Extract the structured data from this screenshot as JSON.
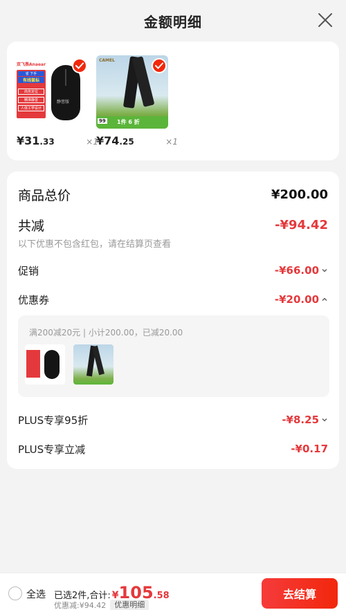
{
  "header": {
    "title": "金额明细"
  },
  "products": [
    {
      "price_int": "¥31",
      "price_dec": ".33",
      "qty": "×1"
    },
    {
      "price_int": "¥74",
      "price_dec": ".25",
      "qty": "×1"
    }
  ],
  "product_image_text": {
    "mouse_brand": "双飞燕Anaear",
    "mouse_tag1": "省 下手",
    "mouse_tag2": "有线鼠标",
    "mouse_tag3": "商务定位",
    "mouse_tag4": "精准静音",
    "mouse_tag5": "人体工学设计",
    "mouse_label": "静音版",
    "camel_brand": "CAMEL",
    "camel_promo": "1件 6 折",
    "camel_badge": "99"
  },
  "summary": {
    "total_label": "商品总价",
    "total_value": "¥200.00",
    "discount_label": "共减",
    "discount_value": "-¥94.42",
    "note": "以下优惠不包含红包，请在结算页查看"
  },
  "items": {
    "promo_label": "促销",
    "promo_value": "-¥66.00",
    "coupon_label": "优惠券",
    "coupon_value": "-¥20.00",
    "coupon_detail": "满200减20元 | 小计200.00，已减20.00",
    "plus95_label": "PLUS专享95折",
    "plus95_value": "-¥8.25",
    "plusdirect_label": "PLUS专享立减",
    "plusdirect_value": "-¥0.17"
  },
  "footer": {
    "select_all": "全选",
    "selected": "已选2件,合计:",
    "total_symbol": "¥",
    "total_int": "105",
    "total_dec": ".58",
    "discount": "优惠减:¥94.42",
    "detail_chip": "优惠明细",
    "checkout": "去结算"
  },
  "colors": {
    "accent": "#e4393c",
    "brand_red": "#f2270c"
  },
  "icons": [
    "close-icon",
    "check-icon",
    "chevron-down-icon",
    "chevron-up-icon",
    "radio-icon"
  ]
}
